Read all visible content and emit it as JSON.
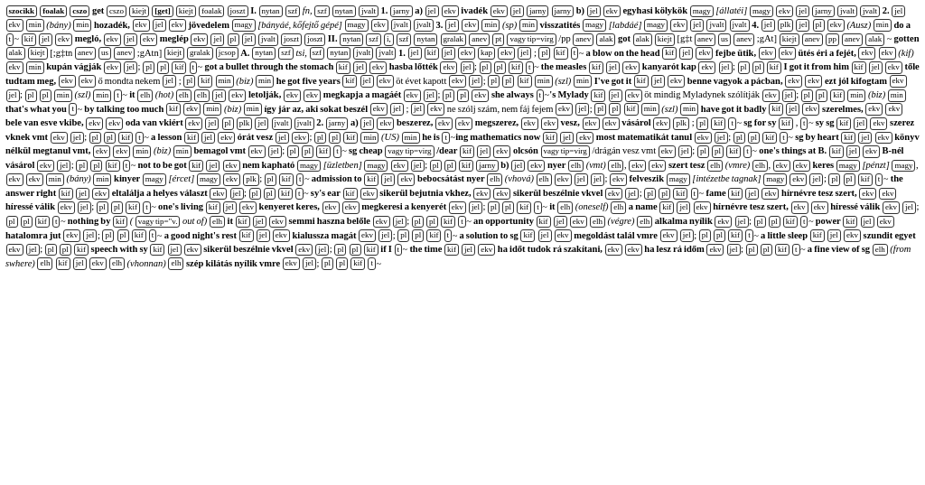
{
  "content": "Dictionary entry content for 'get' showing multiple meanings and examples in Hungarian-English bilingual dictionary format"
}
